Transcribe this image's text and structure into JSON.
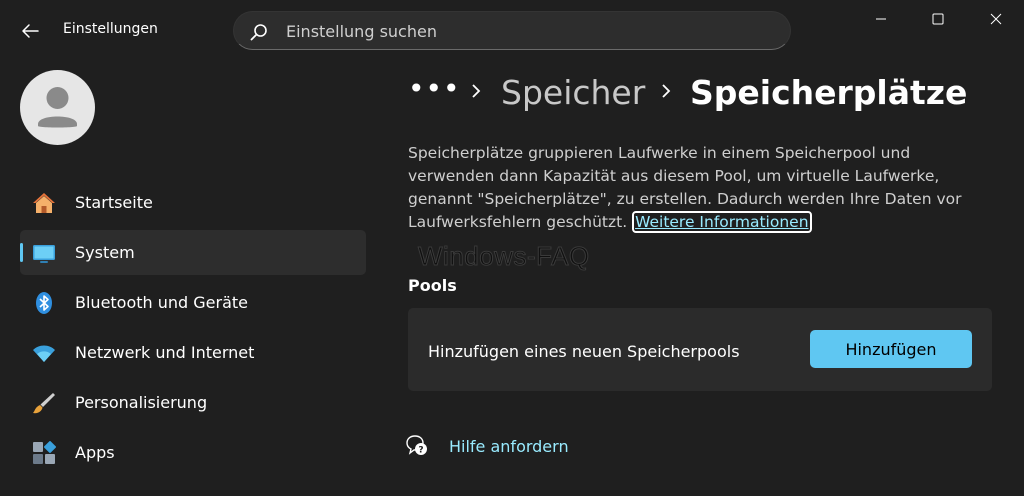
{
  "window": {
    "title": "Einstellungen",
    "controls": [
      "minimize-icon",
      "maximize-icon",
      "close-icon"
    ]
  },
  "search": {
    "placeholder": "Einstellung suchen"
  },
  "sidebar": {
    "items": [
      {
        "label": "Startseite",
        "icon": "home-icon"
      },
      {
        "label": "System",
        "icon": "system-icon",
        "active": true
      },
      {
        "label": "Bluetooth und Geräte",
        "icon": "bluetooth-icon"
      },
      {
        "label": "Netzwerk und Internet",
        "icon": "wifi-icon"
      },
      {
        "label": "Personalisierung",
        "icon": "brush-icon"
      },
      {
        "label": "Apps",
        "icon": "apps-icon"
      }
    ]
  },
  "breadcrumb": {
    "more": "•••",
    "parent": "Speicher",
    "current": "Speicherplätze"
  },
  "description": {
    "text": "Speicherplätze gruppieren Laufwerke in einem Speicherpool und verwenden dann Kapazität aus diesem Pool, um virtuelle Laufwerke, genannt \"Speicherplätze\", zu erstellen. Dadurch werden Ihre Daten vor Laufwerksfehlern geschützt. ",
    "link": "Weitere Informationen"
  },
  "watermark": "Windows-FAQ",
  "pools": {
    "title": "Pools",
    "card_text": "Hinzufügen eines neuen Speicherpools",
    "add_button": "Hinzufügen"
  },
  "help": {
    "label": "Hilfe anfordern"
  },
  "colors": {
    "accent": "#5fc7f2",
    "link": "#99ebff",
    "background": "#1f1f1f",
    "card": "#2b2b2b"
  }
}
